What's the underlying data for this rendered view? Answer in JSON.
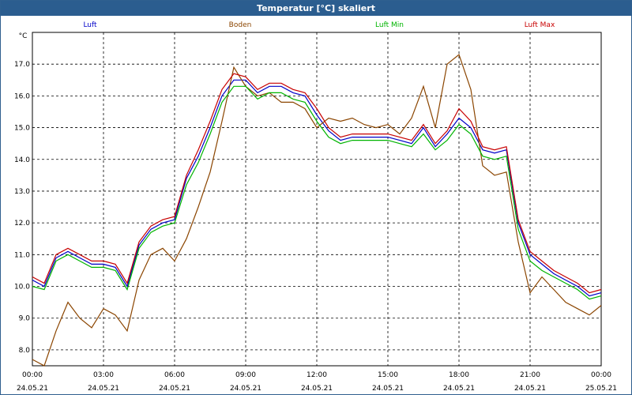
{
  "window": {
    "title": "Temperatur [°C] skaliert"
  },
  "chart_data": {
    "type": "line",
    "title": "Temperatur [°C] skaliert",
    "ylabel": "°C",
    "xlabel": "",
    "ylim": [
      7.5,
      18.0
    ],
    "xlim_hours": [
      0,
      24
    ],
    "grid": true,
    "legend_position": "top",
    "y_ticks": [
      "8.0",
      "9.0",
      "10.0",
      "11.0",
      "12.0",
      "13.0",
      "14.0",
      "15.0",
      "16.0",
      "17.0"
    ],
    "y_tick_values": [
      8,
      9,
      10,
      11,
      12,
      13,
      14,
      15,
      16,
      17
    ],
    "x_ticks": [
      {
        "time": "00:00",
        "date": "24.05.21",
        "hour": 0
      },
      {
        "time": "03:00",
        "date": "24.05.21",
        "hour": 3
      },
      {
        "time": "06:00",
        "date": "24.05.21",
        "hour": 6
      },
      {
        "time": "09:00",
        "date": "24.05.21",
        "hour": 9
      },
      {
        "time": "12:00",
        "date": "24.05.21",
        "hour": 12
      },
      {
        "time": "15:00",
        "date": "24.05.21",
        "hour": 15
      },
      {
        "time": "18:00",
        "date": "24.05.21",
        "hour": 18
      },
      {
        "time": "21:00",
        "date": "24.05.21",
        "hour": 21
      },
      {
        "time": "00:00",
        "date": "25.05.21",
        "hour": 24
      }
    ],
    "x_hours": [
      0,
      0.5,
      1,
      1.5,
      2,
      2.5,
      3,
      3.5,
      4,
      4.5,
      5,
      5.5,
      6,
      6.5,
      7,
      7.5,
      8,
      8.5,
      9,
      9.5,
      10,
      10.5,
      11,
      11.5,
      12,
      12.5,
      13,
      13.5,
      14,
      14.5,
      15,
      15.5,
      16,
      16.5,
      17,
      17.5,
      18,
      18.5,
      19,
      19.5,
      20,
      20.5,
      21,
      21.5,
      22,
      22.5,
      23,
      23.5,
      24
    ],
    "series": [
      {
        "name": "Luft",
        "color": "#0000c8",
        "values": [
          10.2,
          10.0,
          10.9,
          11.1,
          10.9,
          10.7,
          10.7,
          10.6,
          10.0,
          11.3,
          11.8,
          12.0,
          12.1,
          13.4,
          14.1,
          15.0,
          16.0,
          16.5,
          16.5,
          16.1,
          16.3,
          16.3,
          16.1,
          16.0,
          15.4,
          14.9,
          14.6,
          14.7,
          14.7,
          14.7,
          14.7,
          14.6,
          14.5,
          15.0,
          14.4,
          14.8,
          15.3,
          15.0,
          14.3,
          14.2,
          14.3,
          12.0,
          11.0,
          10.7,
          10.4,
          10.2,
          10.0,
          9.7,
          9.8
        ]
      },
      {
        "name": "Boden",
        "color": "#8b4500",
        "values": [
          7.7,
          7.5,
          8.6,
          9.5,
          9.0,
          8.7,
          9.3,
          9.1,
          8.6,
          10.2,
          11.0,
          11.2,
          10.8,
          11.5,
          12.5,
          13.6,
          15.2,
          16.9,
          16.3,
          16.0,
          16.1,
          15.8,
          15.8,
          15.6,
          15.0,
          15.3,
          15.2,
          15.3,
          15.1,
          15.0,
          15.1,
          14.8,
          15.3,
          16.3,
          15.0,
          17.0,
          17.3,
          16.2,
          13.8,
          13.5,
          13.6,
          11.4,
          9.8,
          10.3,
          9.9,
          9.5,
          9.3,
          9.1,
          9.4
        ]
      },
      {
        "name": "Luft Min",
        "color": "#00b400",
        "values": [
          10.0,
          9.9,
          10.8,
          11.0,
          10.8,
          10.6,
          10.6,
          10.5,
          9.9,
          11.2,
          11.7,
          11.9,
          12.0,
          13.2,
          13.9,
          14.8,
          15.8,
          16.3,
          16.3,
          15.9,
          16.1,
          16.1,
          15.9,
          15.8,
          15.2,
          14.7,
          14.5,
          14.6,
          14.6,
          14.6,
          14.6,
          14.5,
          14.4,
          14.8,
          14.3,
          14.6,
          15.1,
          14.8,
          14.1,
          14.0,
          14.1,
          11.8,
          10.8,
          10.5,
          10.3,
          10.1,
          9.9,
          9.6,
          9.7
        ]
      },
      {
        "name": "Luft Max",
        "color": "#c80000",
        "values": [
          10.3,
          10.1,
          11.0,
          11.2,
          11.0,
          10.8,
          10.8,
          10.7,
          10.1,
          11.4,
          11.9,
          12.1,
          12.2,
          13.5,
          14.3,
          15.2,
          16.2,
          16.7,
          16.6,
          16.2,
          16.4,
          16.4,
          16.2,
          16.1,
          15.6,
          15.0,
          14.7,
          14.8,
          14.8,
          14.8,
          14.8,
          14.7,
          14.6,
          15.1,
          14.5,
          14.9,
          15.6,
          15.2,
          14.4,
          14.3,
          14.4,
          12.1,
          11.1,
          10.8,
          10.5,
          10.3,
          10.1,
          9.8,
          9.9
        ]
      }
    ]
  }
}
